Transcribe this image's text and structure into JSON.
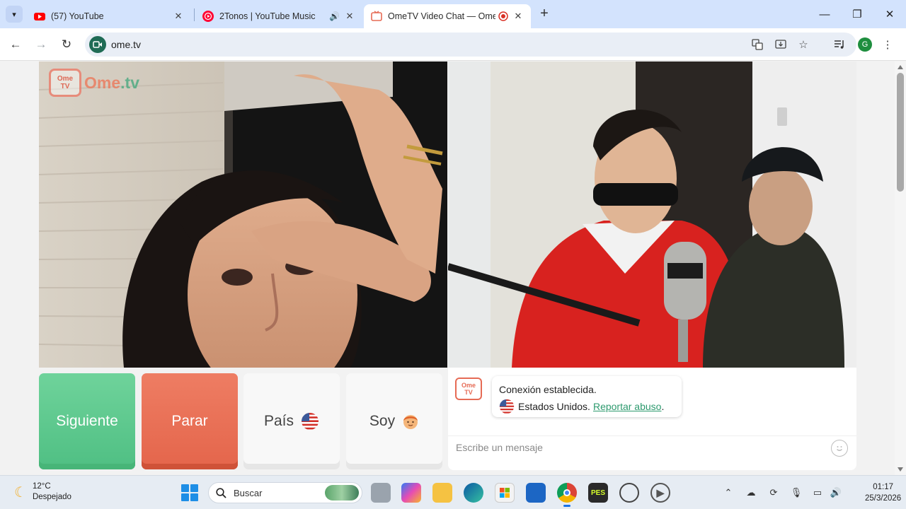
{
  "browser": {
    "tabs": [
      {
        "title": "(57) YouTube",
        "favicon": "youtube-icon",
        "color": "#ff0000"
      },
      {
        "title": "2Tonos | YouTube Music",
        "favicon": "youtube-music-icon",
        "color": "#ff0033"
      },
      {
        "title": "OmeTV Video Chat — Ome",
        "favicon": "ometv-icon",
        "color": "#e66b55",
        "active": true
      }
    ],
    "new_tab_label": "+",
    "url": "ome.tv"
  },
  "page": {
    "logo": {
      "badge_top": "Ome",
      "badge_bottom": "TV",
      "word": "Ome",
      "word_suffix": ".tv"
    },
    "controls": {
      "next_label": "Siguiente",
      "stop_label": "Parar",
      "country_label": "País",
      "soy_label": "Soy"
    },
    "chat": {
      "avatar_top": "Ome",
      "avatar_bottom": "TV",
      "connected_text": "Conexión establecida.",
      "country_text": "Estados Unidos.",
      "report_link": "Reportar abuso",
      "report_suffix": ".",
      "input_placeholder": "Escribe un mensaje"
    }
  },
  "taskbar": {
    "weather_temp": "12°C",
    "weather_desc": "Despejado",
    "search_placeholder": "Buscar",
    "time": "01:17",
    "date": "25/3/2026"
  }
}
